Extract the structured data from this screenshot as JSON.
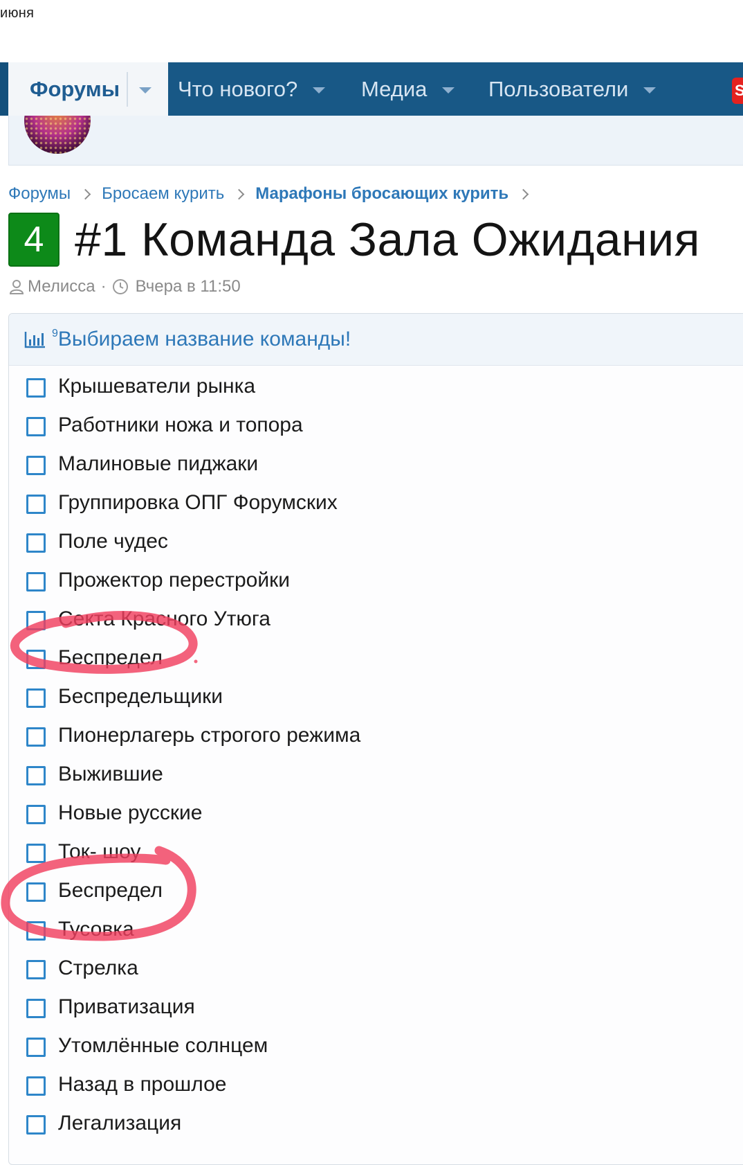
{
  "status": {
    "date": "июня"
  },
  "nav": {
    "tabs": [
      {
        "label": "Форумы",
        "active": true
      },
      {
        "label": "Что нового?",
        "active": false
      },
      {
        "label": "Медиа",
        "active": false
      },
      {
        "label": "Пользователи",
        "active": false
      }
    ],
    "badge": "S"
  },
  "breadcrumb": [
    {
      "label": "Форумы"
    },
    {
      "label": "Бросаем курить"
    },
    {
      "label": "Марафоны бросающих курить"
    }
  ],
  "thread": {
    "reply_count": "4",
    "title": "#1 Команда Зала Ожидания",
    "author": "Мелисса",
    "time": "Вчера в 11:50"
  },
  "poll": {
    "votes": "9",
    "title": "Выбираем название команды!",
    "options": [
      "Крышеватели рынка",
      "Работники ножа и топора",
      "Малиновые пиджаки",
      "Группировка ОПГ Форумских",
      "Поле чудес",
      "Прожектор перестройки",
      "Секта Красного Утюга",
      "Беспредел",
      "Беспредельщики",
      "Пионерлагерь строгого режима",
      "Выжившие",
      "Новые русские",
      "Ток- шоу",
      "Беспредел",
      "Тусовка",
      "Стрелка",
      "Приватизация",
      "Утомлённые солнцем",
      "Назад в прошлое",
      "Легализация"
    ]
  },
  "colors": {
    "nav_bg": "#185886",
    "link": "#2e78b8",
    "badge_green": "#0d8a19",
    "annotation": "#f0405f"
  }
}
